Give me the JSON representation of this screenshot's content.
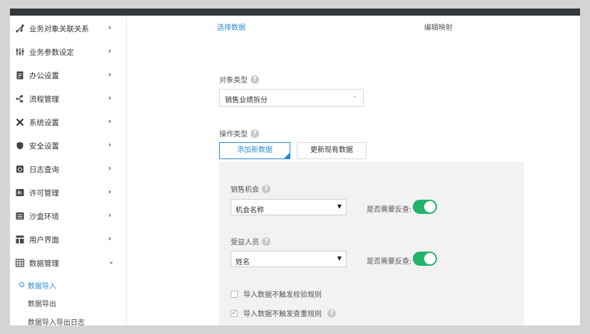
{
  "sidebar": {
    "items": [
      {
        "label": "业务对象关联关系",
        "icon": "share-icon"
      },
      {
        "label": "业务参数设定",
        "icon": "sliders-icon"
      },
      {
        "label": "办公设置",
        "icon": "document-icon"
      },
      {
        "label": "流程管理",
        "icon": "flow-icon"
      },
      {
        "label": "系统设置",
        "icon": "tools-icon"
      },
      {
        "label": "安全设置",
        "icon": "shield-icon"
      },
      {
        "label": "日志查询",
        "icon": "log-icon"
      },
      {
        "label": "许可管理",
        "icon": "license-icon"
      },
      {
        "label": "沙盒环境",
        "icon": "sandbox-icon"
      },
      {
        "label": "用户界面",
        "icon": "layout-icon"
      },
      {
        "label": "数据管理",
        "icon": "table-icon"
      }
    ],
    "sub_items": [
      {
        "label": "数据导入",
        "active": true
      },
      {
        "label": "数据导出",
        "active": false
      },
      {
        "label": "数据导入导出日志",
        "active": false
      }
    ]
  },
  "steps": {
    "step1": "选择数据",
    "step2": "编辑映射"
  },
  "form": {
    "object_type_label": "对象类型",
    "object_type_value": "销售业绩拆分",
    "operation_type_label": "操作类型",
    "add_button": "添加新数据",
    "update_button": "更新现有数据"
  },
  "panel": {
    "opportunity_label": "销售机会",
    "opportunity_value": "机会名称",
    "beneficiary_label": "受益人员",
    "beneficiary_value": "姓名",
    "reverse_check_label": "是否需要反查:",
    "checkbox1_label": "导入数据不触发校验规则",
    "checkbox1_checked": false,
    "checkbox2_label": "导入数据不触发查重规则",
    "checkbox2_checked": true
  },
  "colors": {
    "accent": "#2b8bd6",
    "toggle_on": "#24b36b",
    "topbar": "#34373c"
  }
}
